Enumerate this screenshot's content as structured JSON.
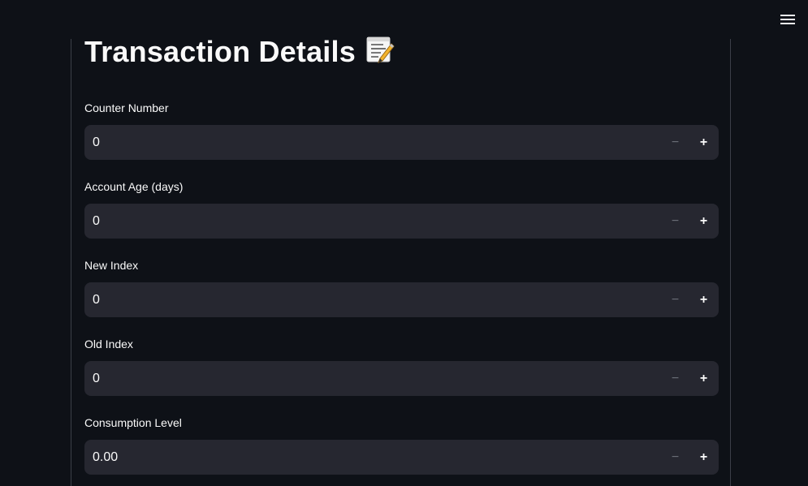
{
  "page": {
    "title": "Transaction Details",
    "title_emoji": "memo-emoji"
  },
  "menu": {
    "icon": "hamburger-menu-icon"
  },
  "fields": [
    {
      "label": "Counter Number",
      "value": "0"
    },
    {
      "label": "Account Age (days)",
      "value": "0"
    },
    {
      "label": "New Index",
      "value": "0"
    },
    {
      "label": "Old Index",
      "value": "0"
    },
    {
      "label": "Consumption Level",
      "value": "0.00"
    }
  ],
  "controls": {
    "minus": "−",
    "plus": "+"
  },
  "colors": {
    "background": "#0e1117",
    "input_background": "#262730",
    "text": "#fafafa",
    "muted": "#6b6f78",
    "divider": "#3b3f48"
  }
}
